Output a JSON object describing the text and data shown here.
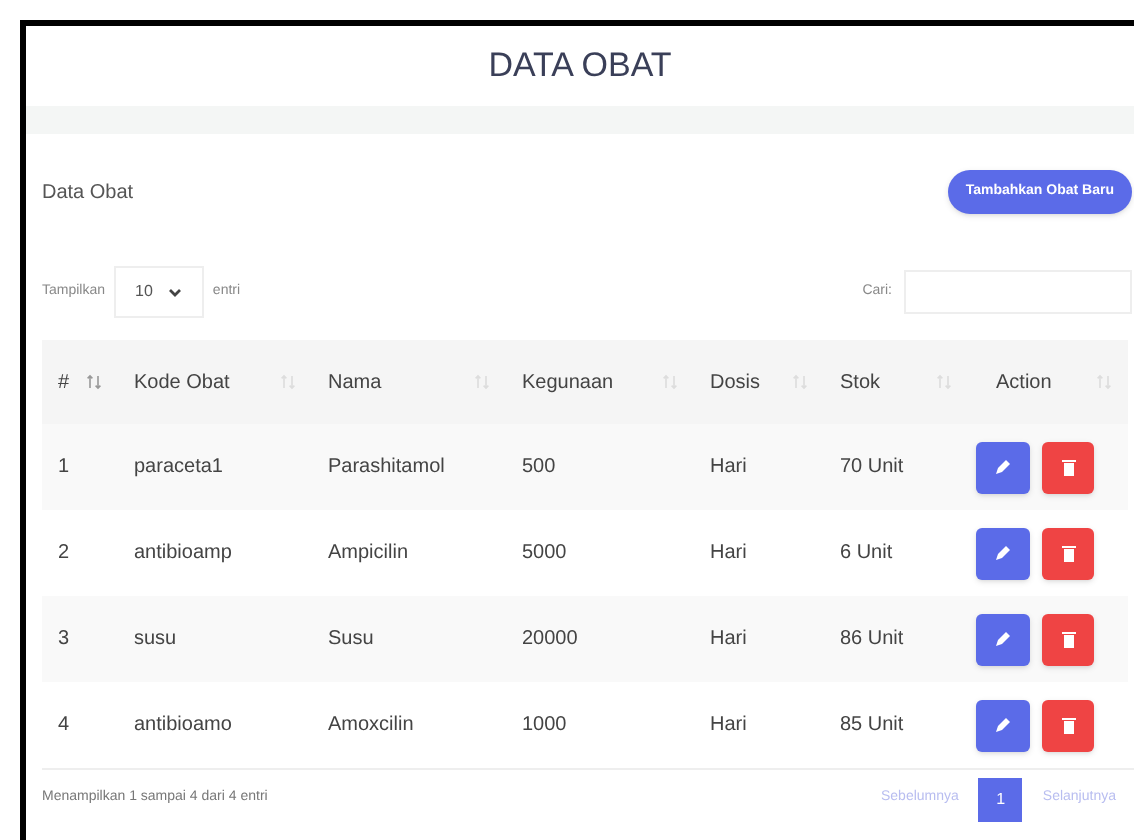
{
  "page_title": "DATA OBAT",
  "card": {
    "title": "Data Obat",
    "add_button": "Tambahkan Obat Baru"
  },
  "length_control": {
    "prefix": "Tampilkan",
    "value": "10",
    "suffix": "entri"
  },
  "search": {
    "label": "Cari:"
  },
  "table": {
    "columns": [
      {
        "label": "#"
      },
      {
        "label": "Kode Obat"
      },
      {
        "label": "Nama"
      },
      {
        "label": "Kegunaan"
      },
      {
        "label": "Dosis"
      },
      {
        "label": "Stok"
      },
      {
        "label": "Action"
      }
    ],
    "rows": [
      {
        "cells": [
          "1",
          "paraceta1",
          "Parashitamol",
          "500",
          "Hari",
          "70 Unit"
        ]
      },
      {
        "cells": [
          "2",
          "antibioamp",
          "Ampicilin",
          "5000",
          "Hari",
          "6 Unit"
        ]
      },
      {
        "cells": [
          "3",
          "susu",
          "Susu",
          "20000",
          "Hari",
          "86 Unit"
        ]
      },
      {
        "cells": [
          "4",
          "antibioamo",
          "Amoxcilin",
          "1000",
          "Hari",
          "85 Unit"
        ]
      }
    ]
  },
  "footer": {
    "info": "Menampilkan 1 sampai 4 dari 4 entri",
    "pagination": [
      {
        "label": "Sebelumnya",
        "kind": "nav",
        "disabled": true,
        "selected": false
      },
      {
        "label": "1",
        "kind": "page",
        "selected": true
      },
      {
        "label": "Selanjutnya",
        "kind": "nav",
        "disabled": true,
        "selected": false
      }
    ]
  }
}
